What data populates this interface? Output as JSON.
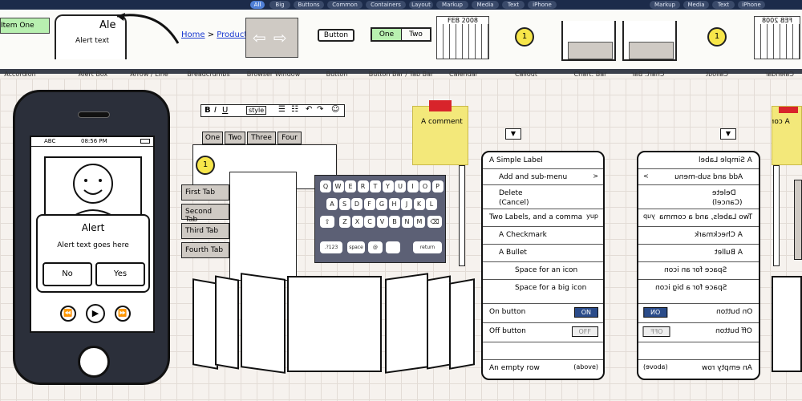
{
  "topbar": {
    "tabs": [
      "All",
      "Big",
      "Buttons",
      "Common",
      "Containers",
      "Layout",
      "Markup",
      "Media",
      "Text",
      "iPhone"
    ],
    "mirror_tabs": [
      "Markup",
      "Media",
      "Text",
      "iPhone"
    ]
  },
  "library": {
    "accordion": {
      "item": "Item One",
      "label": "Accordion"
    },
    "alert": {
      "title": "Ale",
      "text": "Alert text",
      "label": "Alert Box"
    },
    "arrow": {
      "label": "Arrow / Line"
    },
    "breadcrumbs": {
      "home": "Home",
      "sep": ">",
      "product": "Product",
      "label": "Breadcrumbs"
    },
    "browser": {
      "label": "Browser Window"
    },
    "button": {
      "text": "Button",
      "label": "Button"
    },
    "buttonbar": {
      "one": "One",
      "two": "Two",
      "label": "Button Bar / Tab Bar"
    },
    "calendar": {
      "month": "FEB 2008",
      "label": "Calendar"
    },
    "callout": {
      "num": "1",
      "label": "Callout"
    },
    "chartbar": {
      "label": "Chart: Bar Chart"
    },
    "mirror_chart": {
      "label": "Chart: Bar Chart"
    },
    "mirror_callout": {
      "num": "1",
      "label": "Callout"
    },
    "mirror_calendar": {
      "month": "FEB 2008",
      "label": "Calendar"
    }
  },
  "iphone": {
    "carrier": "ABC",
    "time": "08:56 PM",
    "alert_title": "Alert",
    "alert_text": "Alert text goes here",
    "no": "No",
    "yes": "Yes"
  },
  "toolbar": {
    "bold": "B",
    "italic": "I",
    "underline": "U",
    "style": "style"
  },
  "tabs": {
    "top": [
      "One",
      "Two",
      "Three",
      "Four"
    ],
    "side": [
      "First Tab",
      "Second Tab",
      "Third Tab",
      "Fourth Tab"
    ]
  },
  "callout_num": "1",
  "keyboard": {
    "row1": [
      "Q",
      "W",
      "E",
      "R",
      "T",
      "Y",
      "U",
      "I",
      "O",
      "P"
    ],
    "row2": [
      "A",
      "S",
      "D",
      "F",
      "G",
      "H",
      "J",
      "K",
      "L"
    ],
    "row3": [
      "Z",
      "X",
      "C",
      "V",
      "B",
      "N",
      "M"
    ],
    "num": ".?123",
    "space": "space",
    "at": "@",
    ".": ".",
    "ret": "return"
  },
  "sticky": {
    "text": "A comment"
  },
  "list": {
    "items": [
      {
        "text": "A Simple Label",
        "right": ""
      },
      {
        "text": "Add and sub-menu",
        "right": ">"
      },
      {
        "text": "Delete\n(Cancel)",
        "right": ""
      },
      {
        "text": "Two Labels, and a comma",
        "right": "yup"
      },
      {
        "text": "A Checkmark",
        "right": ""
      },
      {
        "text": "A Bullet",
        "right": ""
      },
      {
        "text": "Space for an icon",
        "right": ""
      },
      {
        "text": "Space for a big icon",
        "right": ""
      },
      {
        "text": "On button",
        "right": "ON"
      },
      {
        "text": "Off button",
        "right": "OFF"
      },
      {
        "text": "",
        "right": ""
      },
      {
        "text": "An empty row",
        "right": "(above)"
      }
    ]
  },
  "mirror_sticky": {
    "text": "A comment"
  }
}
